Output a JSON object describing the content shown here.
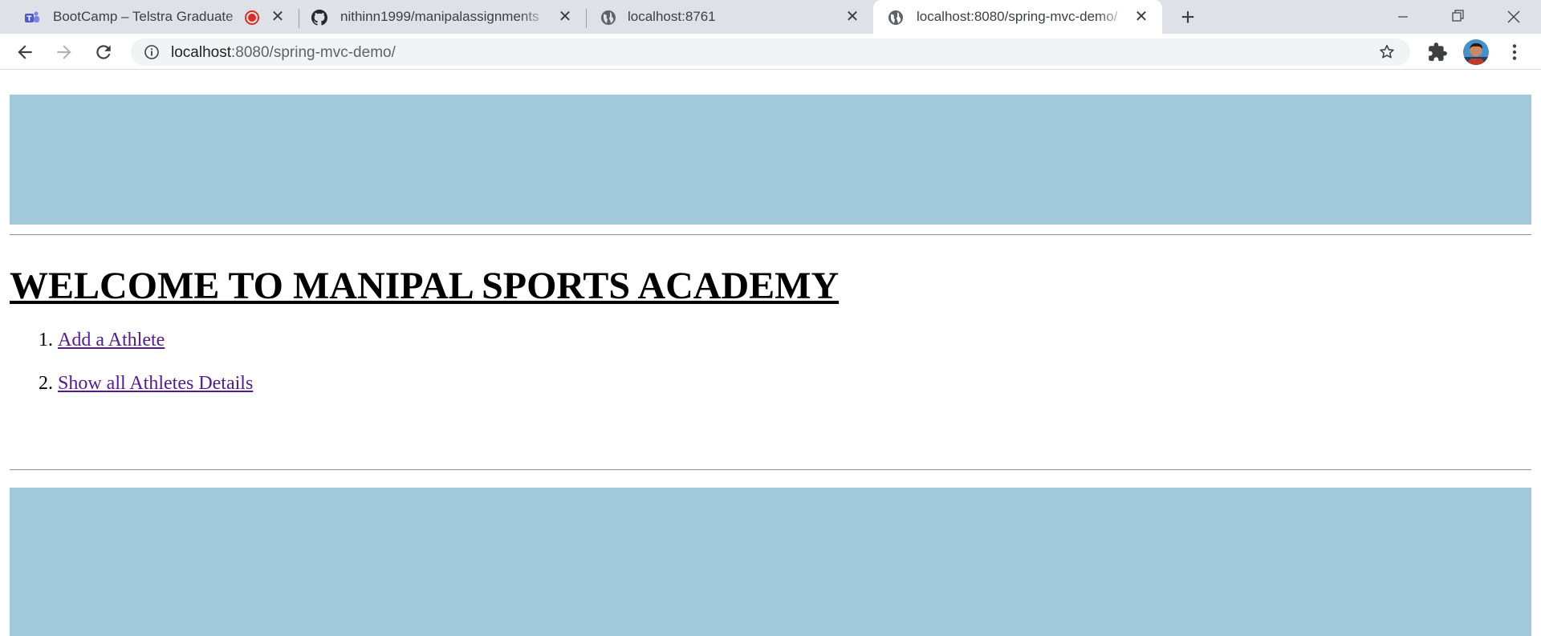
{
  "browser": {
    "tabs": [
      {
        "title": "BootCamp – Telstra Graduate",
        "recording": true
      },
      {
        "title": "nithinn1999/manipalassignments"
      },
      {
        "title": "localhost:8761"
      },
      {
        "title": "localhost:8080/spring-mvc-demo/",
        "active": true
      }
    ],
    "address": {
      "host": "localhost",
      "rest": ":8080/spring-mvc-demo/"
    },
    "colors": {
      "tabstrip": "#dee1e6",
      "teams": "#5059c9",
      "record": "#d93025"
    }
  },
  "page": {
    "heading": "WELCOME TO MANIPAL SPORTS ACADEMY",
    "links": [
      {
        "number": "1.",
        "label": "Add a Athlete"
      },
      {
        "number": "2.",
        "label": "Show all Athletes Details"
      }
    ],
    "colors": {
      "banner": "#a2c9da",
      "link_visited": "#551a8b"
    }
  }
}
